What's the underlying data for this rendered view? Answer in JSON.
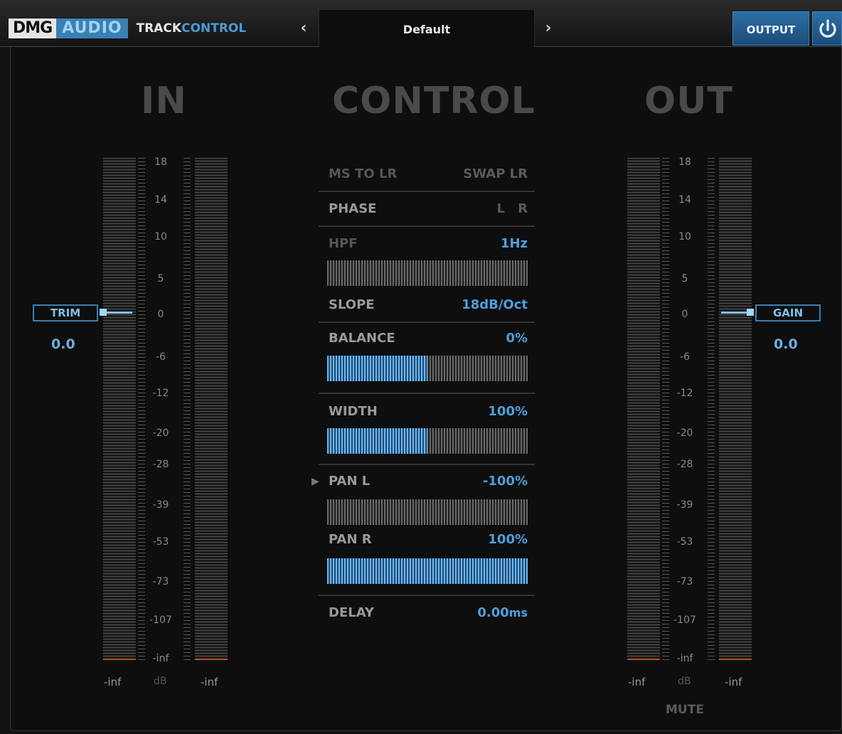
{
  "header": {
    "logo_dmg": "DMG",
    "logo_audio": "AUDIO",
    "product_track": "TRACK",
    "product_control": "CONTROL",
    "preset_prev": "‹",
    "preset_name": "Default",
    "preset_next": "›",
    "output_label": "OUTPUT",
    "power_icon": "power-icon"
  },
  "sections": {
    "in": "IN",
    "control": "CONTROL",
    "out": "OUT"
  },
  "meter_scale": [
    "18",
    "14",
    "10",
    "5",
    "0",
    "-6",
    "-12",
    "-20",
    "-28",
    "-39",
    "-53",
    "-73",
    "-107",
    "-inf"
  ],
  "input": {
    "trim_label": "TRIM",
    "trim_value": "0.0",
    "left_readout": "-inf",
    "unit": "dB",
    "right_readout": "-inf"
  },
  "output": {
    "gain_label": "GAIN",
    "gain_value": "0.0",
    "left_readout": "-inf",
    "unit": "dB",
    "right_readout": "-inf",
    "mute_label": "MUTE"
  },
  "control": {
    "ms_to_lr": "MS TO LR",
    "swap_lr": "SWAP LR",
    "phase_label": "PHASE",
    "phase_l": "L",
    "phase_r": "R",
    "hpf_label": "HPF",
    "hpf_value": "1Hz",
    "hpf_level": 0,
    "slope_label": "SLOPE",
    "slope_value": "18dB/Oct",
    "balance_label": "BALANCE",
    "balance_value": "0%",
    "balance_level": 0.5,
    "width_label": "WIDTH",
    "width_value": "100%",
    "width_level": 0.5,
    "pan_l_marker": "▶",
    "pan_l_label": "PAN L",
    "pan_l_value": "-100%",
    "pan_l_level": 0,
    "pan_r_label": "PAN R",
    "pan_r_value": "100%",
    "pan_r_level": 1,
    "delay_label": "DELAY",
    "delay_value": "0.00",
    "delay_unit": "ms"
  },
  "colors": {
    "accent": "#4f9fdb",
    "meter_floor": "#b5521e"
  }
}
